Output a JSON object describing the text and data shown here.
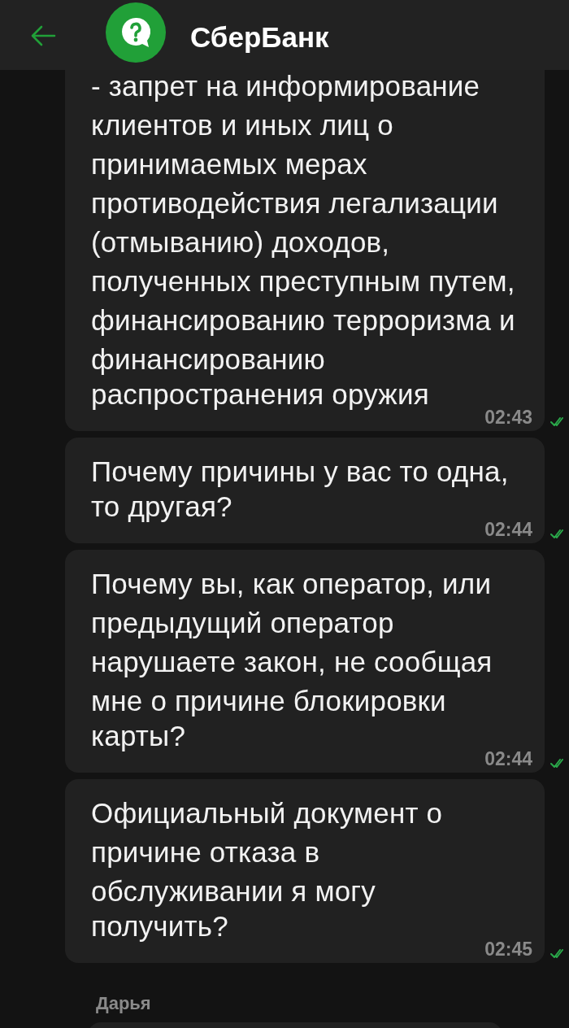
{
  "header": {
    "title": "СберБанк"
  },
  "messages": [
    {
      "lines": [
        "- запрет на информирование",
        "клиентов и иных лиц о",
        "принимаемых мерах",
        "противодействия легализации",
        "(отмыванию) доходов,",
        "полученных преступным путем,",
        "финансированию терроризма и",
        "финансированию",
        "распространения оружия"
      ],
      "time": "02:43",
      "read": true
    },
    {
      "lines": [
        "Почему причины у вас то одна,",
        "то другая?"
      ],
      "time": "02:44",
      "read": true
    },
    {
      "lines": [
        "Почему вы, как оператор, или",
        "предыдущий оператор",
        "нарушаете закон, не сообщая",
        "мне о причине блокировки",
        "карты?"
      ],
      "time": "02:44",
      "read": true
    },
    {
      "lines": [
        "Официальный документ о",
        "причине отказа в",
        "обслуживании я могу",
        "получить?"
      ],
      "time": "02:45",
      "read": true
    }
  ],
  "incoming": {
    "sender": "Дарья"
  }
}
